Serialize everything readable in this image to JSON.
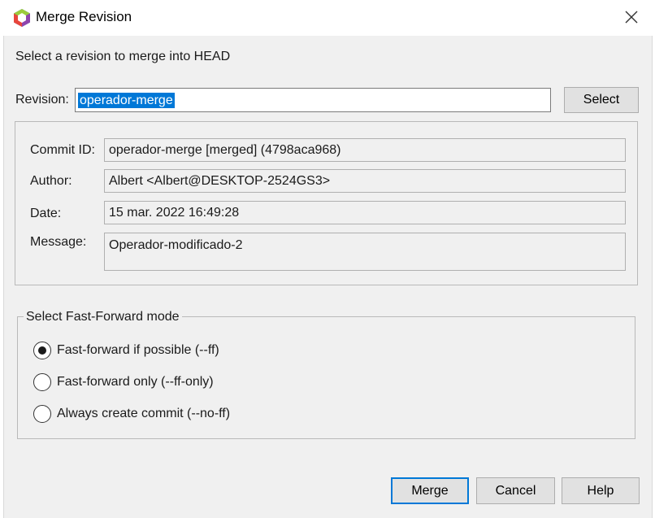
{
  "window": {
    "title": "Merge Revision"
  },
  "dialog": {
    "description": "Select a revision to merge into HEAD",
    "revision_label": "Revision:",
    "revision_value": "operador-merge",
    "select_button": "Select"
  },
  "info": {
    "commit_id_label": "Commit ID:",
    "commit_id_value": "operador-merge [merged] (4798aca968)",
    "author_label": "Author:",
    "author_value": "Albert <Albert@DESKTOP-2524GS3>",
    "date_label": "Date:",
    "date_value": "15 mar. 2022 16:49:28",
    "message_label": "Message:",
    "message_value": "Operador-modificado-2"
  },
  "ff_mode": {
    "title": "Select Fast-Forward mode",
    "options": [
      {
        "label": "Fast-forward if possible (--ff)",
        "selected": true
      },
      {
        "label": "Fast-forward only (--ff-only)",
        "selected": false
      },
      {
        "label": "Always create commit (--no-ff)",
        "selected": false
      }
    ]
  },
  "buttons": {
    "merge": "Merge",
    "cancel": "Cancel",
    "help": "Help"
  },
  "colors": {
    "accent": "#0078d7",
    "window_bg": "#f0f0f0"
  },
  "icons": {
    "app": "netbeans-cube-icon",
    "close": "close-icon"
  }
}
